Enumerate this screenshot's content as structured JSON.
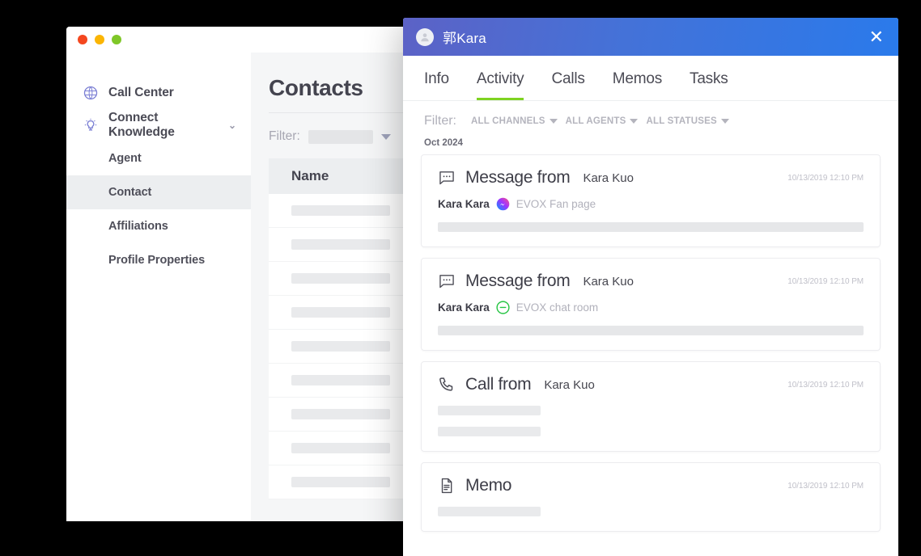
{
  "app": {
    "window_controls": [
      "close",
      "minimize",
      "maximize"
    ],
    "sidebar": {
      "items": [
        {
          "label": "Call Center",
          "icon": "headset-globe-icon",
          "type": "top"
        },
        {
          "label": "Connect Knowledge",
          "icon": "lightbulb-icon",
          "type": "top",
          "expandable": true
        },
        {
          "label": "Agent",
          "type": "sub",
          "active": false
        },
        {
          "label": "Contact",
          "type": "sub",
          "active": true
        },
        {
          "label": "Affiliations",
          "type": "sub",
          "active": false
        },
        {
          "label": "Profile Properties",
          "type": "sub",
          "active": false
        }
      ]
    },
    "content": {
      "title": "Contacts",
      "filter_label": "Filter:",
      "filter_value": "",
      "table": {
        "columns": [
          "Name"
        ],
        "row_count": 9,
        "rows_placeholder": true
      }
    }
  },
  "modal": {
    "title": "郭Kara",
    "avatar": "contact-avatar",
    "close_label": "✕",
    "tabs": [
      {
        "label": "Info",
        "active": false
      },
      {
        "label": "Activity",
        "active": true
      },
      {
        "label": "Calls",
        "active": false
      },
      {
        "label": "Memos",
        "active": false
      },
      {
        "label": "Tasks",
        "active": false
      }
    ],
    "filter_label": "Filter:",
    "filters": [
      {
        "label": "ALL CHANNELS"
      },
      {
        "label": "ALL AGENTS"
      },
      {
        "label": "ALL STATUSES"
      }
    ],
    "month_group": "Oct 2024",
    "activities": [
      {
        "icon": "message-bubble-icon",
        "title": "Message from",
        "person": "Kara Kuo",
        "timestamp": "10/13/2019 12:10 PM",
        "sub_name": "Kara Kara",
        "channel_icon": "messenger-icon",
        "channel": "EVOX Fan page",
        "body_style": "wide-bar"
      },
      {
        "icon": "message-bubble-icon",
        "title": "Message from",
        "person": "Kara Kuo",
        "timestamp": "10/13/2019 12:10 PM",
        "sub_name": "Kara Kara",
        "channel_icon": "line-icon",
        "channel": "EVOX chat room",
        "body_style": "wide-bar"
      },
      {
        "icon": "phone-icon",
        "title": "Call from",
        "person": "Kara Kuo",
        "timestamp": "10/13/2019 12:10 PM",
        "sub_name": "",
        "channel_icon": "",
        "channel": "",
        "body_style": "two-small-bars"
      },
      {
        "icon": "document-icon",
        "title": "Memo",
        "person": "",
        "timestamp": "10/13/2019 12:10 PM",
        "sub_name": "",
        "channel_icon": "",
        "channel": "",
        "body_style": "one-small-bar"
      }
    ]
  },
  "colors": {
    "header_gradient_start": "#5c62c6",
    "header_gradient_end": "#2a7aeb",
    "active_tab_underline": "#7ed321",
    "sidebar_icon": "#7b7fd4",
    "messenger_badge": "#9b4ae0",
    "line_badge": "#27c544",
    "background": "#000000"
  }
}
